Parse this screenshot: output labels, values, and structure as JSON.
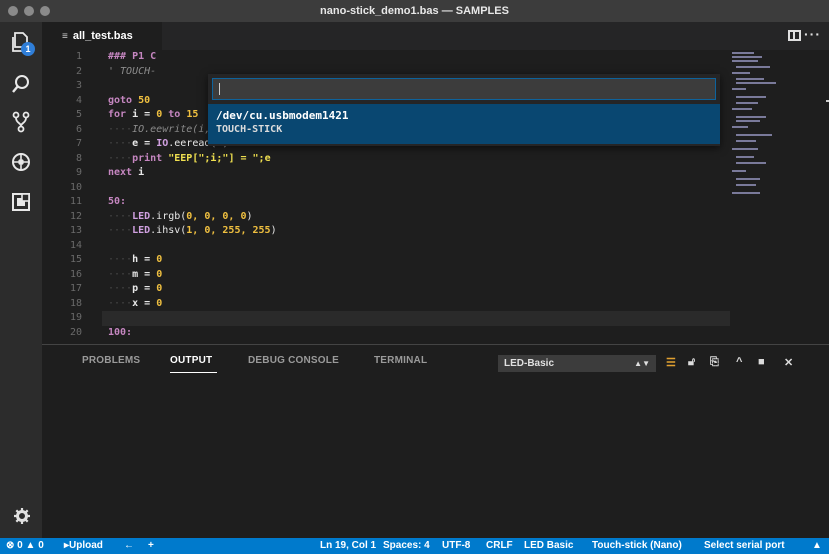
{
  "window": {
    "title": "nano-stick_demo1.bas — SAMPLES"
  },
  "activity_bar": {
    "explorer_badge": "1",
    "icons": [
      "files-icon",
      "search-icon",
      "source-control-icon",
      "debug-icon",
      "extensions-icon",
      "gear-icon"
    ]
  },
  "editor_tab": {
    "label": "all_test.bas",
    "icon": "≡"
  },
  "quick_pick": {
    "input_value": "",
    "item_title": "/dev/cu.usbmodem1421",
    "item_description": "TOUCH-STICK"
  },
  "code": {
    "line_numbers": [
      "1",
      "2",
      "3",
      "4",
      "5",
      "6",
      "7",
      "8",
      "9",
      "10",
      "11",
      "12",
      "13",
      "14",
      "15",
      "16",
      "17",
      "18",
      "19",
      "20"
    ],
    "line1": "### P1 C",
    "line2": "' TOUCH-",
    "line4_kw": "goto",
    "line4_num": "50",
    "line5_for": "for",
    "line5_i": "i",
    "line5_eq": " = ",
    "line5_from": "0",
    "line5_to": "to",
    "line5_end": "15",
    "line6": "IO.eewrite(i, 2300 + i)",
    "line7_var": "e",
    "line7_eq": " = ",
    "line7_obj": "IO",
    "line7_fn": ".eeread(",
    "line7_arg": "i",
    "line7_close": ")",
    "line8_kw": "print",
    "line8_str": "\"EEP[\";i;\"] = \";e",
    "line9_kw": "next",
    "line9_var": "i",
    "line11": "50:",
    "line12_obj": "LED",
    "line12_fn": ".irgb(",
    "line12_args": "0, 0, 0, 0",
    "line12_close": ")",
    "line13_obj": "LED",
    "line13_fn": ".ihsv(",
    "line13_args": "1, 0, 255, 255",
    "line13_close": ")",
    "line15_var": "h",
    "line15_val": "0",
    "line16_var": "m",
    "line16_val": "0",
    "line17_var": "p",
    "line17_val": "0",
    "line18_var": "x",
    "line18_val": "0",
    "line20": "100:",
    "current_line": 19
  },
  "panel": {
    "tabs": [
      "PROBLEMS",
      "OUTPUT",
      "DEBUG CONSOLE",
      "TERMINAL"
    ],
    "active_tab": "OUTPUT",
    "channel": "LED-Basic"
  },
  "status_bar": {
    "errors": "0",
    "warnings": "0",
    "upload": "Upload",
    "position": "Ln 19, Col 1",
    "spaces": "Spaces: 4",
    "encoding": "UTF-8",
    "eol": "CRLF",
    "language": "LED Basic",
    "device": "Touch-stick (Nano)",
    "serial": "Select serial port"
  },
  "colors": {
    "accent": "#007acc",
    "selection": "#094771",
    "keyword": "#c586c0",
    "number": "#f0c040"
  }
}
